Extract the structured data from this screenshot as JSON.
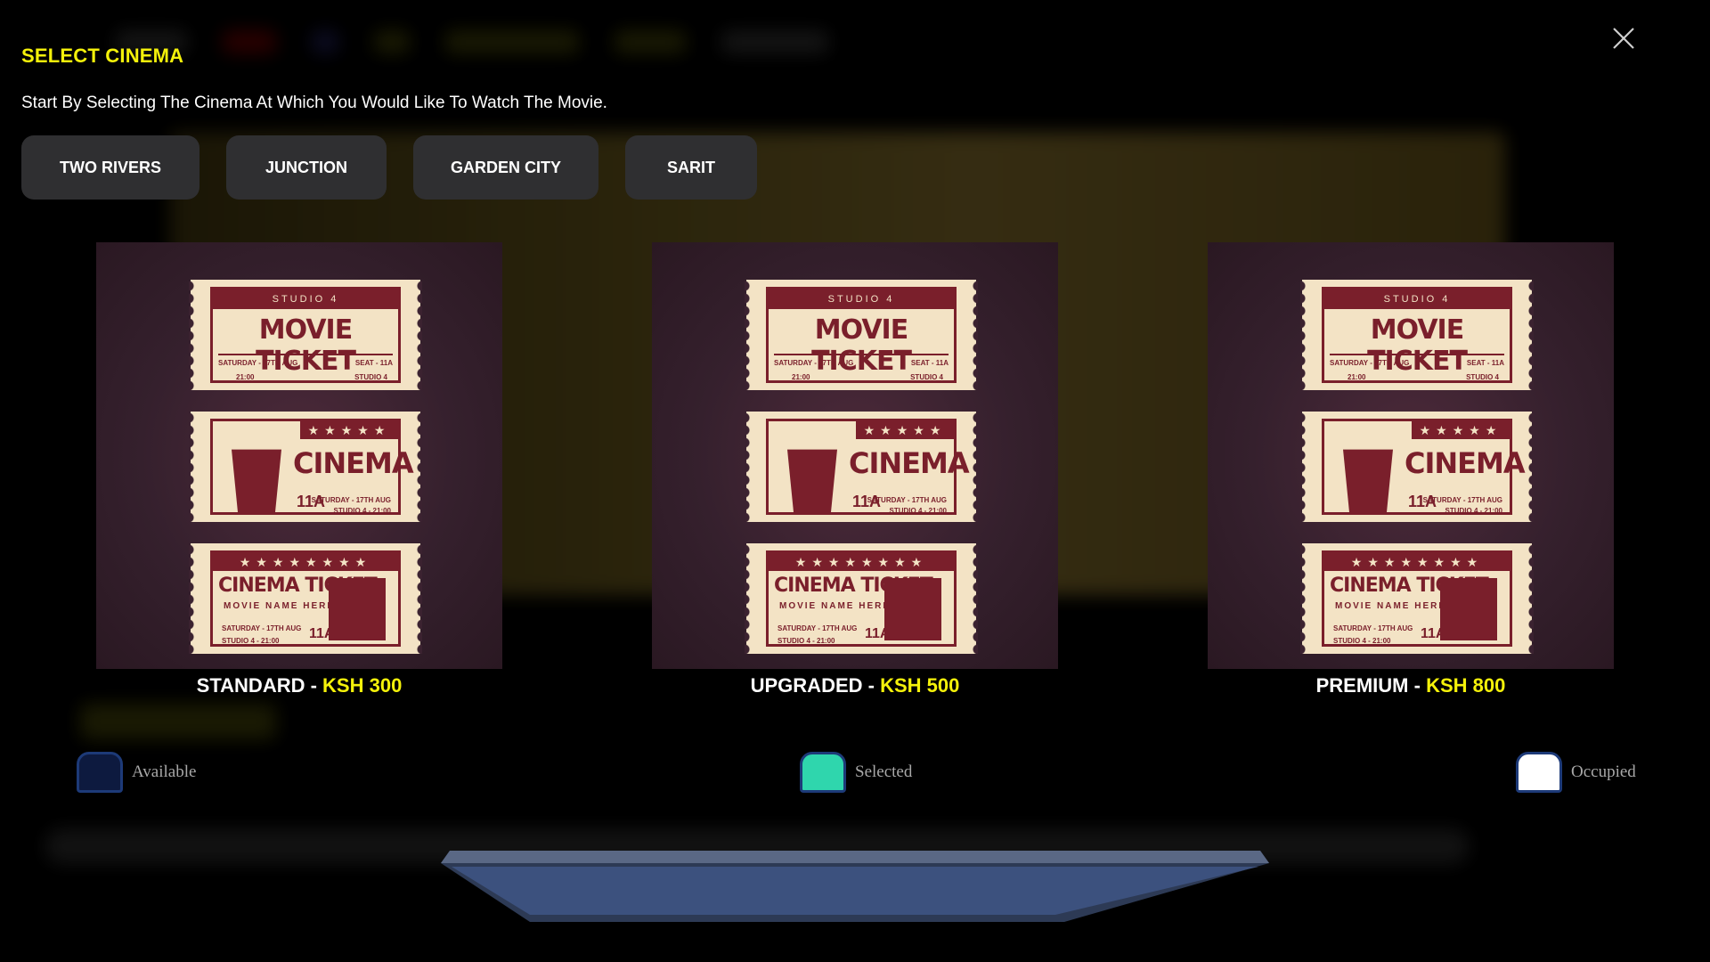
{
  "modal": {
    "title": "SELECT CINEMA",
    "subtitle": "Start By Selecting The Cinema At Which You Would Like To Watch The Movie.",
    "close_icon": "close-icon"
  },
  "cinemas": [
    {
      "label": "TWO RIVERS"
    },
    {
      "label": "JUNCTION"
    },
    {
      "label": "GARDEN CITY"
    },
    {
      "label": "SARIT"
    }
  ],
  "ticket_image": {
    "top": "MOVIE TICKET",
    "top_header": "STUDIO 4",
    "middle": "CINEMA",
    "middle_seat": "11A",
    "bottom": "CINEMA TICKET",
    "bottom_sub": "MOVIE NAME HERE",
    "bottom_seat": "11A",
    "date": "SATURDAY - 17TH AUG",
    "time": "21:00",
    "seat": "SEAT - 11A",
    "studio": "STUDIO 4",
    "studio_time": "STUDIO 4 - 21:00"
  },
  "tickets": [
    {
      "tier": "STANDARD",
      "separator": " - ",
      "price": "KSH 300"
    },
    {
      "tier": "UPGRADED",
      "separator": " - ",
      "price": "KSH 500"
    },
    {
      "tier": "PREMIUM",
      "separator": " - ",
      "price": "KSH 800"
    }
  ],
  "legend": [
    {
      "label": "Available",
      "color": "#0d1a3f"
    },
    {
      "label": "Selected",
      "color": "#2fd6ad"
    },
    {
      "label": "Occupied",
      "color": "#ffffff"
    }
  ],
  "colors": {
    "accent": "#f4f10a",
    "tab_bg": "#2f2f31",
    "ticket_maroon": "#7a1f2b",
    "ticket_cream": "#f3e3c5"
  }
}
